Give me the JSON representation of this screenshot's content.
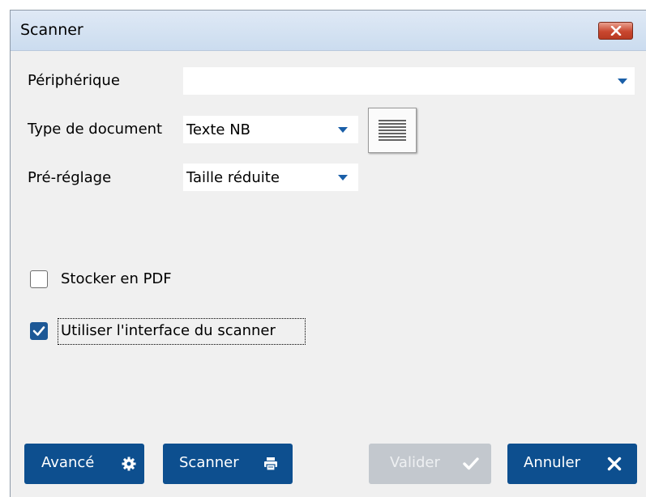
{
  "window": {
    "title": "Scanner"
  },
  "form": {
    "device_label": "Périphérique",
    "device_value": "",
    "doc_type_label": "Type de document",
    "doc_type_value": "Texte NB",
    "preset_label": "Pré-réglage",
    "preset_value": "Taille réduite"
  },
  "options": {
    "store_pdf_label": "Stocker en PDF",
    "store_pdf_checked": false,
    "use_interface_label": "Utiliser l'interface du scanner",
    "use_interface_checked": true
  },
  "buttons": {
    "advanced": "Avancé",
    "scan": "Scanner",
    "validate": "Valider",
    "cancel": "Annuler"
  },
  "colors": {
    "accent": "#0d4f8f",
    "disabled": "#c3c8ce",
    "close": "#c9472f"
  },
  "icons": {
    "close": "close-icon",
    "advanced": "gear-icon",
    "scan": "printer-icon",
    "validate": "checkmark-icon",
    "cancel": "x-icon",
    "doc_type": "text-document-icon"
  }
}
